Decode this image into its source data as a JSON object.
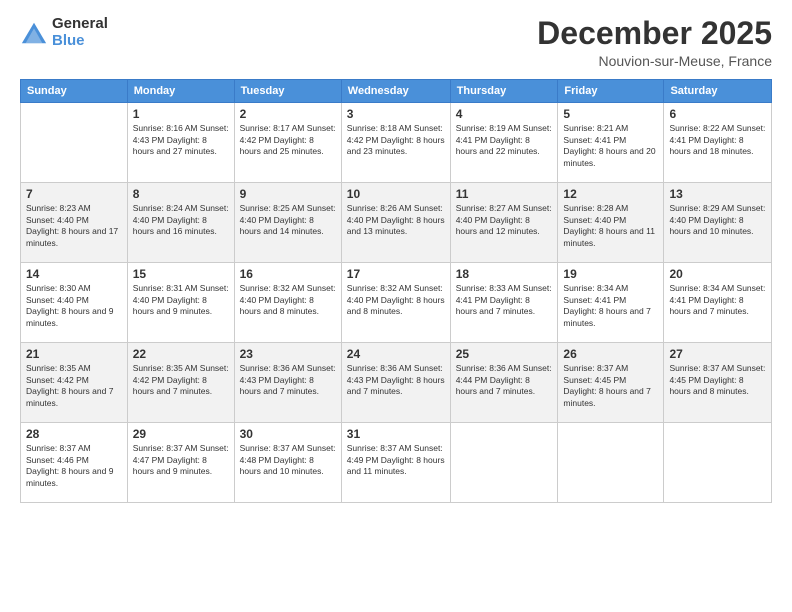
{
  "logo": {
    "general": "General",
    "blue": "Blue"
  },
  "title": "December 2025",
  "location": "Nouvion-sur-Meuse, France",
  "days_header": [
    "Sunday",
    "Monday",
    "Tuesday",
    "Wednesday",
    "Thursday",
    "Friday",
    "Saturday"
  ],
  "weeks": [
    [
      {
        "day": "",
        "info": ""
      },
      {
        "day": "1",
        "info": "Sunrise: 8:16 AM\nSunset: 4:43 PM\nDaylight: 8 hours\nand 27 minutes."
      },
      {
        "day": "2",
        "info": "Sunrise: 8:17 AM\nSunset: 4:42 PM\nDaylight: 8 hours\nand 25 minutes."
      },
      {
        "day": "3",
        "info": "Sunrise: 8:18 AM\nSunset: 4:42 PM\nDaylight: 8 hours\nand 23 minutes."
      },
      {
        "day": "4",
        "info": "Sunrise: 8:19 AM\nSunset: 4:41 PM\nDaylight: 8 hours\nand 22 minutes."
      },
      {
        "day": "5",
        "info": "Sunrise: 8:21 AM\nSunset: 4:41 PM\nDaylight: 8 hours\nand 20 minutes."
      },
      {
        "day": "6",
        "info": "Sunrise: 8:22 AM\nSunset: 4:41 PM\nDaylight: 8 hours\nand 18 minutes."
      }
    ],
    [
      {
        "day": "7",
        "info": "Sunrise: 8:23 AM\nSunset: 4:40 PM\nDaylight: 8 hours\nand 17 minutes."
      },
      {
        "day": "8",
        "info": "Sunrise: 8:24 AM\nSunset: 4:40 PM\nDaylight: 8 hours\nand 16 minutes."
      },
      {
        "day": "9",
        "info": "Sunrise: 8:25 AM\nSunset: 4:40 PM\nDaylight: 8 hours\nand 14 minutes."
      },
      {
        "day": "10",
        "info": "Sunrise: 8:26 AM\nSunset: 4:40 PM\nDaylight: 8 hours\nand 13 minutes."
      },
      {
        "day": "11",
        "info": "Sunrise: 8:27 AM\nSunset: 4:40 PM\nDaylight: 8 hours\nand 12 minutes."
      },
      {
        "day": "12",
        "info": "Sunrise: 8:28 AM\nSunset: 4:40 PM\nDaylight: 8 hours\nand 11 minutes."
      },
      {
        "day": "13",
        "info": "Sunrise: 8:29 AM\nSunset: 4:40 PM\nDaylight: 8 hours\nand 10 minutes."
      }
    ],
    [
      {
        "day": "14",
        "info": "Sunrise: 8:30 AM\nSunset: 4:40 PM\nDaylight: 8 hours\nand 9 minutes."
      },
      {
        "day": "15",
        "info": "Sunrise: 8:31 AM\nSunset: 4:40 PM\nDaylight: 8 hours\nand 9 minutes."
      },
      {
        "day": "16",
        "info": "Sunrise: 8:32 AM\nSunset: 4:40 PM\nDaylight: 8 hours\nand 8 minutes."
      },
      {
        "day": "17",
        "info": "Sunrise: 8:32 AM\nSunset: 4:40 PM\nDaylight: 8 hours\nand 8 minutes."
      },
      {
        "day": "18",
        "info": "Sunrise: 8:33 AM\nSunset: 4:41 PM\nDaylight: 8 hours\nand 7 minutes."
      },
      {
        "day": "19",
        "info": "Sunrise: 8:34 AM\nSunset: 4:41 PM\nDaylight: 8 hours\nand 7 minutes."
      },
      {
        "day": "20",
        "info": "Sunrise: 8:34 AM\nSunset: 4:41 PM\nDaylight: 8 hours\nand 7 minutes."
      }
    ],
    [
      {
        "day": "21",
        "info": "Sunrise: 8:35 AM\nSunset: 4:42 PM\nDaylight: 8 hours\nand 7 minutes."
      },
      {
        "day": "22",
        "info": "Sunrise: 8:35 AM\nSunset: 4:42 PM\nDaylight: 8 hours\nand 7 minutes."
      },
      {
        "day": "23",
        "info": "Sunrise: 8:36 AM\nSunset: 4:43 PM\nDaylight: 8 hours\nand 7 minutes."
      },
      {
        "day": "24",
        "info": "Sunrise: 8:36 AM\nSunset: 4:43 PM\nDaylight: 8 hours\nand 7 minutes."
      },
      {
        "day": "25",
        "info": "Sunrise: 8:36 AM\nSunset: 4:44 PM\nDaylight: 8 hours\nand 7 minutes."
      },
      {
        "day": "26",
        "info": "Sunrise: 8:37 AM\nSunset: 4:45 PM\nDaylight: 8 hours\nand 7 minutes."
      },
      {
        "day": "27",
        "info": "Sunrise: 8:37 AM\nSunset: 4:45 PM\nDaylight: 8 hours\nand 8 minutes."
      }
    ],
    [
      {
        "day": "28",
        "info": "Sunrise: 8:37 AM\nSunset: 4:46 PM\nDaylight: 8 hours\nand 9 minutes."
      },
      {
        "day": "29",
        "info": "Sunrise: 8:37 AM\nSunset: 4:47 PM\nDaylight: 8 hours\nand 9 minutes."
      },
      {
        "day": "30",
        "info": "Sunrise: 8:37 AM\nSunset: 4:48 PM\nDaylight: 8 hours\nand 10 minutes."
      },
      {
        "day": "31",
        "info": "Sunrise: 8:37 AM\nSunset: 4:49 PM\nDaylight: 8 hours\nand 11 minutes."
      },
      {
        "day": "",
        "info": ""
      },
      {
        "day": "",
        "info": ""
      },
      {
        "day": "",
        "info": ""
      }
    ]
  ]
}
